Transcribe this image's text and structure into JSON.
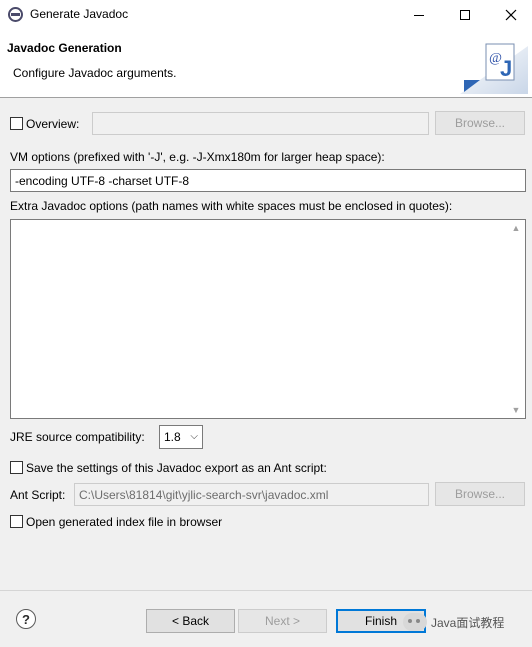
{
  "window": {
    "title": "Generate Javadoc",
    "icons": {
      "app": "eclipse-icon",
      "minimize": "minimize-icon",
      "maximize": "maximize-icon",
      "close": "close-icon"
    }
  },
  "header": {
    "title": "Javadoc Generation",
    "description": "Configure Javadoc arguments.",
    "graphic_icon": "javadoc-wizard-icon",
    "graphic_text": "@"
  },
  "overview": {
    "label": "Overview:",
    "checked": false,
    "value": "",
    "browse_label": "Browse..."
  },
  "vm_options": {
    "label": "VM options (prefixed with '-J', e.g. -J-Xmx180m for larger heap space):",
    "value": "-encoding UTF-8 -charset UTF-8"
  },
  "extra_options": {
    "label": "Extra Javadoc options (path names with white spaces must be enclosed in quotes):",
    "value": ""
  },
  "jre": {
    "label": "JRE source compatibility:",
    "selected": "1.8"
  },
  "ant": {
    "save_label": "Save the settings of this Javadoc export as an Ant script:",
    "save_checked": false,
    "script_label": "Ant Script:",
    "script_value": "C:\\Users\\81814\\git\\yjlic-search-svr\\javadoc.xml",
    "browse_label": "Browse..."
  },
  "open_index": {
    "label": "Open generated index file in browser",
    "checked": false
  },
  "footer": {
    "help_icon": "help-icon",
    "help_glyph": "?",
    "back_label": "< Back",
    "next_label": "Next >",
    "finish_label": "Finish",
    "watermark_text": "Java面试教程"
  }
}
